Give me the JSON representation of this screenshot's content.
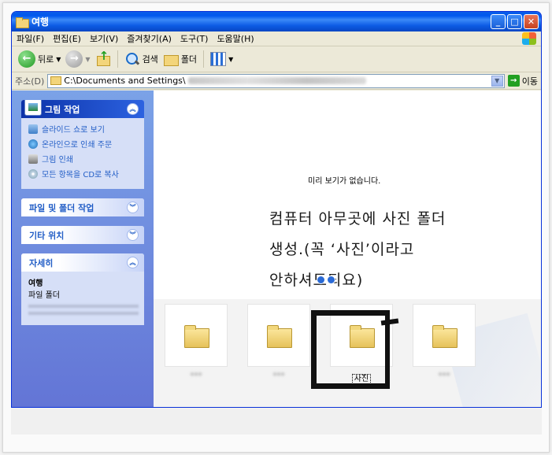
{
  "window": {
    "title": "여행",
    "controls": {
      "minimize": "_",
      "maximize": "□",
      "close": "✕"
    }
  },
  "menu": [
    "파일(F)",
    "편집(E)",
    "보기(V)",
    "즐겨찾기(A)",
    "도구(T)",
    "도움말(H)"
  ],
  "toolbar": {
    "back": "뒤로",
    "search": "검색",
    "folders": "폴더"
  },
  "address": {
    "label": "주소(D)",
    "value": "C:\\Documents and Settings\\",
    "go": "이동"
  },
  "sidebar": {
    "picture_tasks": {
      "title": "그림 작업",
      "items": [
        "슬라이드 쇼로 보기",
        "온라인으로 인쇄 주문",
        "그림 인쇄",
        "모든 항목을 CD로 복사"
      ]
    },
    "file_folder_tasks": {
      "title": "파일 및 폴더 작업"
    },
    "other_places": {
      "title": "기타 위치"
    },
    "details": {
      "title": "자세히",
      "name": "여행",
      "type": "파일 폴더"
    }
  },
  "content": {
    "preview_message": "미리 보기가 없습니다.",
    "annotation": [
      "컴퓨터 아무곳에 사진 폴더",
      "생성.(꼭 ‘사진’이라고",
      "안하셔도되요)"
    ],
    "folders": [
      {
        "label": "***",
        "blurred": true
      },
      {
        "label": "***",
        "blurred": true
      },
      {
        "label": "사진",
        "blurred": false,
        "selected": true
      },
      {
        "label": "***",
        "blurred": true
      }
    ]
  },
  "icons": {
    "back": "back-arrow-icon",
    "forward": "forward-arrow-icon",
    "up": "folder-up-icon",
    "search": "search-icon",
    "folders": "folder-icon",
    "views": "views-icon",
    "go": "go-arrow-icon"
  }
}
